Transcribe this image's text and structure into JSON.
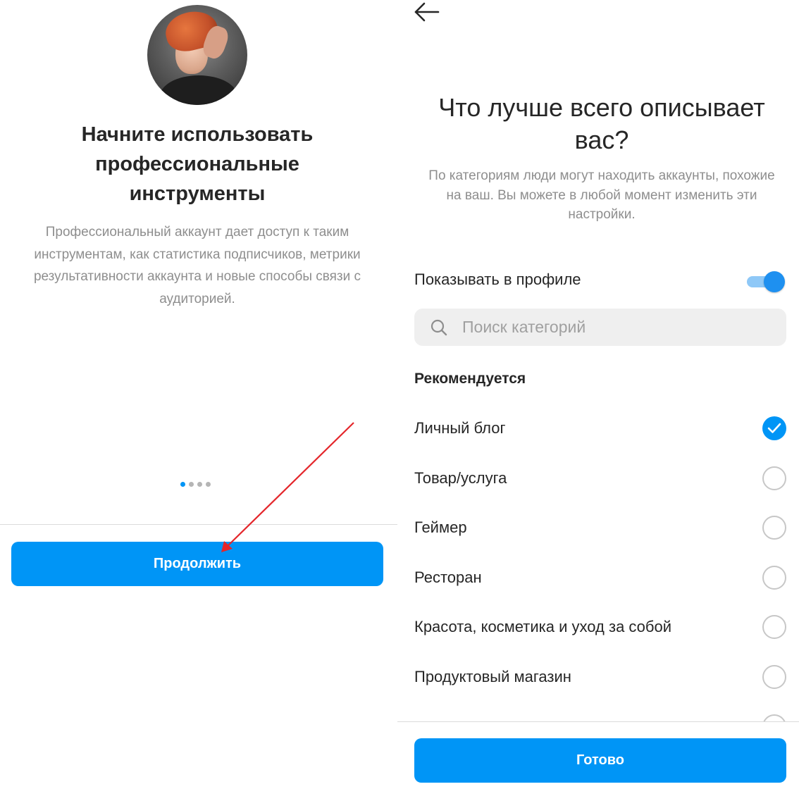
{
  "left": {
    "title": "Начните использовать профессиональные инструменты",
    "description": "Профессиональный аккаунт дает доступ к таким инструментам, как статистика подписчиков, метрики результативности аккаунта и новые способы связи с аудиторией.",
    "pager": {
      "pages": 4,
      "current": 1
    },
    "continue_label": "Продолжить"
  },
  "right": {
    "title": "Что лучше всего описывает вас?",
    "description": "По категориям люди могут находить аккаунты, похожие на ваш. Вы можете в любой момент изменить эти настройки.",
    "show_in_profile_label": "Показывать в профиле",
    "show_in_profile_on": true,
    "search_placeholder": "Поиск категорий",
    "section_heading": "Рекомендуется",
    "categories": [
      {
        "label": "Личный блог",
        "selected": true
      },
      {
        "label": "Товар/услуга",
        "selected": false
      },
      {
        "label": "Геймер",
        "selected": false
      },
      {
        "label": "Ресторан",
        "selected": false
      },
      {
        "label": "Красота, косметика и уход за собой",
        "selected": false
      },
      {
        "label": "Продуктовый магазин",
        "selected": false
      },
      {
        "label": "",
        "selected": false
      }
    ],
    "done_label": "Готово"
  },
  "colors": {
    "primary": "#0095f6",
    "annotation_arrow": "#e4262b",
    "muted_text": "#8e8e8e"
  },
  "icons": [
    "avatar-photo",
    "back-arrow-icon",
    "search-icon",
    "toggle-switch",
    "checkmark-icon"
  ]
}
